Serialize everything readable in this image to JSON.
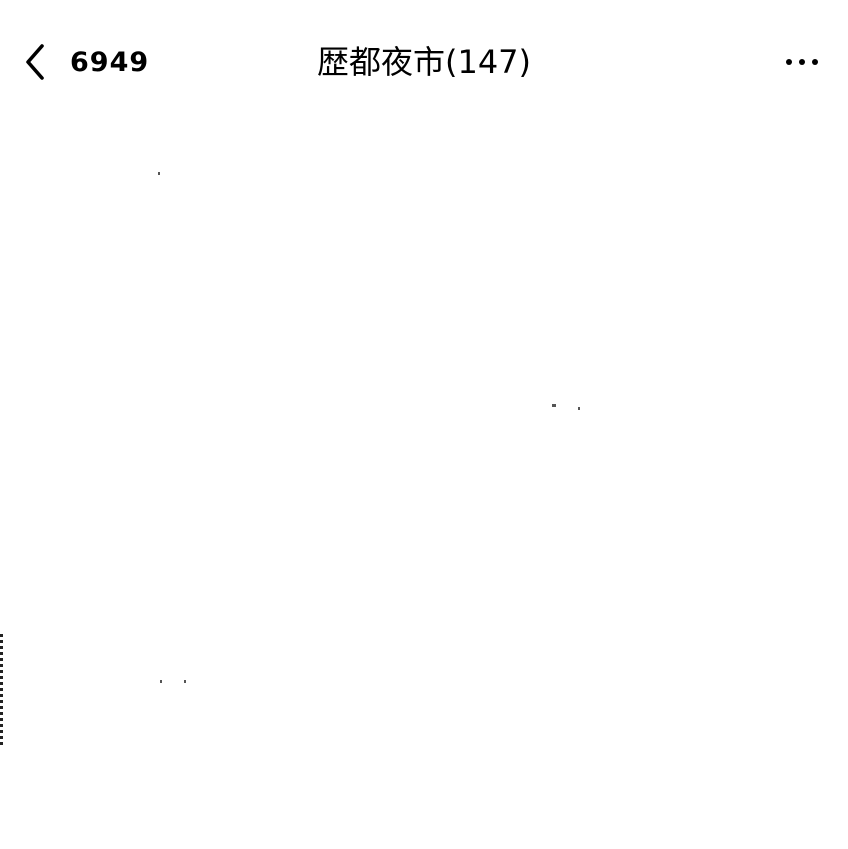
{
  "nav": {
    "back_count": "6949",
    "title": "歴都夜市(147)",
    "back_icon": "chevron-left-icon",
    "more_icon": "ellipsis-icon"
  },
  "colors": {
    "background": "#ffffff",
    "text": "#000000"
  }
}
